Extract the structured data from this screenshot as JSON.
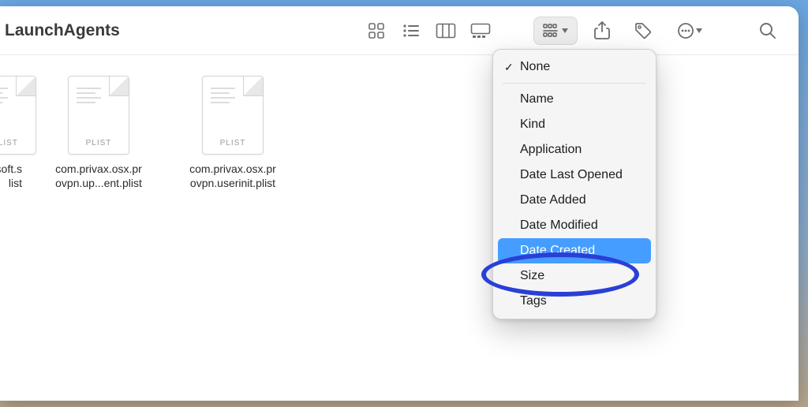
{
  "window": {
    "title": "LaunchAgents"
  },
  "files": [
    {
      "name": "soft.s\nlist",
      "ext": "PLIST"
    },
    {
      "name": "com.privax.osx.pr\novpn.up...ent.plist",
      "ext": "PLIST"
    },
    {
      "name": "com.privax.osx.pr\novpn.userinit.plist",
      "ext": "PLIST"
    }
  ],
  "group_menu": {
    "items": [
      {
        "label": "None",
        "checked": true
      },
      {
        "label": "Name"
      },
      {
        "label": "Kind"
      },
      {
        "label": "Application"
      },
      {
        "label": "Date Last Opened"
      },
      {
        "label": "Date Added"
      },
      {
        "label": "Date Modified"
      },
      {
        "label": "Date Created",
        "highlighted": true
      },
      {
        "label": "Size"
      },
      {
        "label": "Tags"
      }
    ]
  }
}
